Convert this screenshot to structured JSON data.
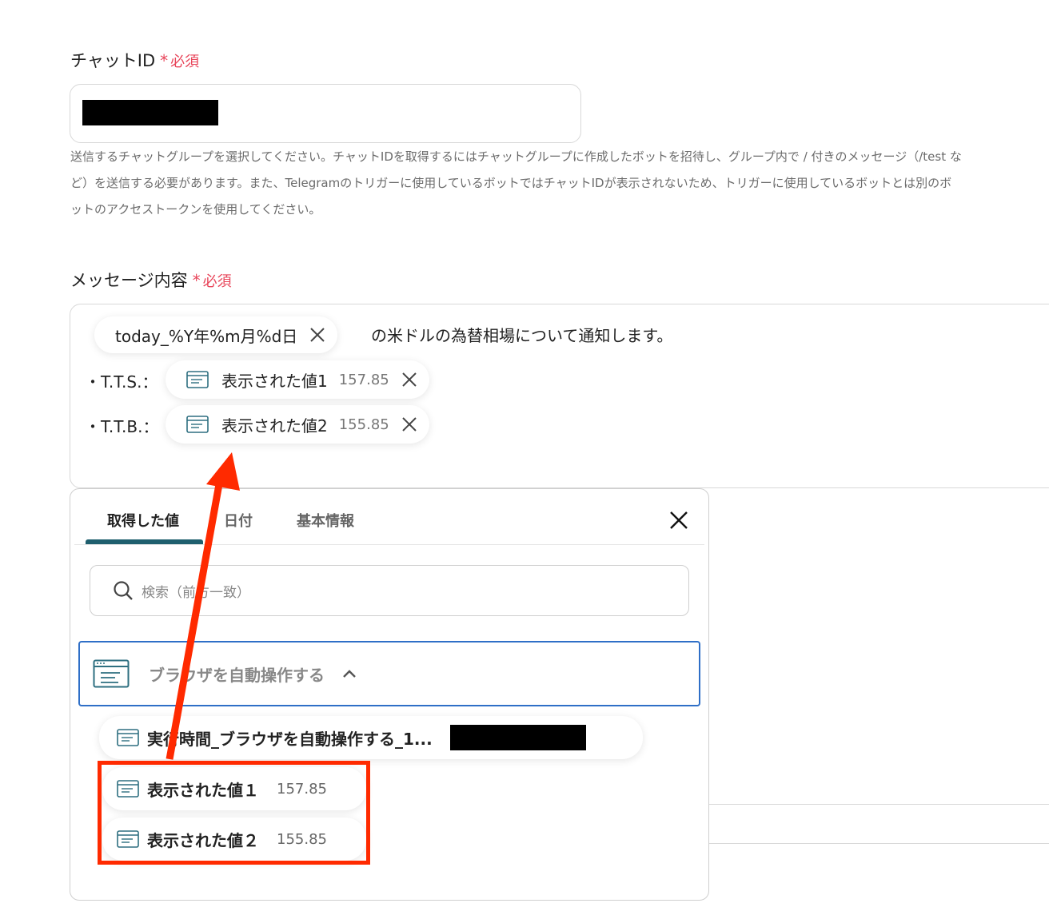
{
  "chat_id": {
    "label": "チャットID",
    "required": "必須",
    "required_mark": "*",
    "help_line1": "送信するチャットグループを選択してください。チャットIDを取得するにはチャットグループに作成したボットを招待し、グループ内で / 付きのメッセージ（/test な",
    "help_line2": "ど）を送信する必要があります。また、Telegramのトリガーに使用しているボットではチャットIDが表示されないため、トリガーに使用しているボットとは別のボ",
    "help_line3": "ットのアクセストークンを使用してください。"
  },
  "message": {
    "label": "メッセージ内容",
    "required": "必須",
    "required_mark": "*",
    "date_chip": "today_%Y年%m月%d日",
    "text_after_date": "の米ドルの為替相場について通知します。",
    "tts_label": "・T.T.S.：",
    "ttb_label": "・T.T.B.：",
    "chip1_name": "表示された値1",
    "chip1_value": "157.85",
    "chip2_name": "表示された値2",
    "chip2_value": "155.85"
  },
  "panel": {
    "tabs": [
      {
        "label": "取得した値",
        "active": true
      },
      {
        "label": "日付",
        "active": false
      },
      {
        "label": "基本情報",
        "active": false
      }
    ],
    "search_placeholder": "検索（前方一致）",
    "group_title": "ブラウザを自動操作する",
    "items": [
      {
        "name": "実行時間_ブラウザを自動操作する_1...",
        "value": ""
      },
      {
        "name": "表示された値１",
        "value": "157.85"
      },
      {
        "name": "表示された値２",
        "value": "155.85"
      }
    ]
  },
  "colors": {
    "required": "#e8455a",
    "tab_underline": "#1f5f6e",
    "group_border": "#2f6fc7",
    "highlight": "#ff2a00"
  }
}
